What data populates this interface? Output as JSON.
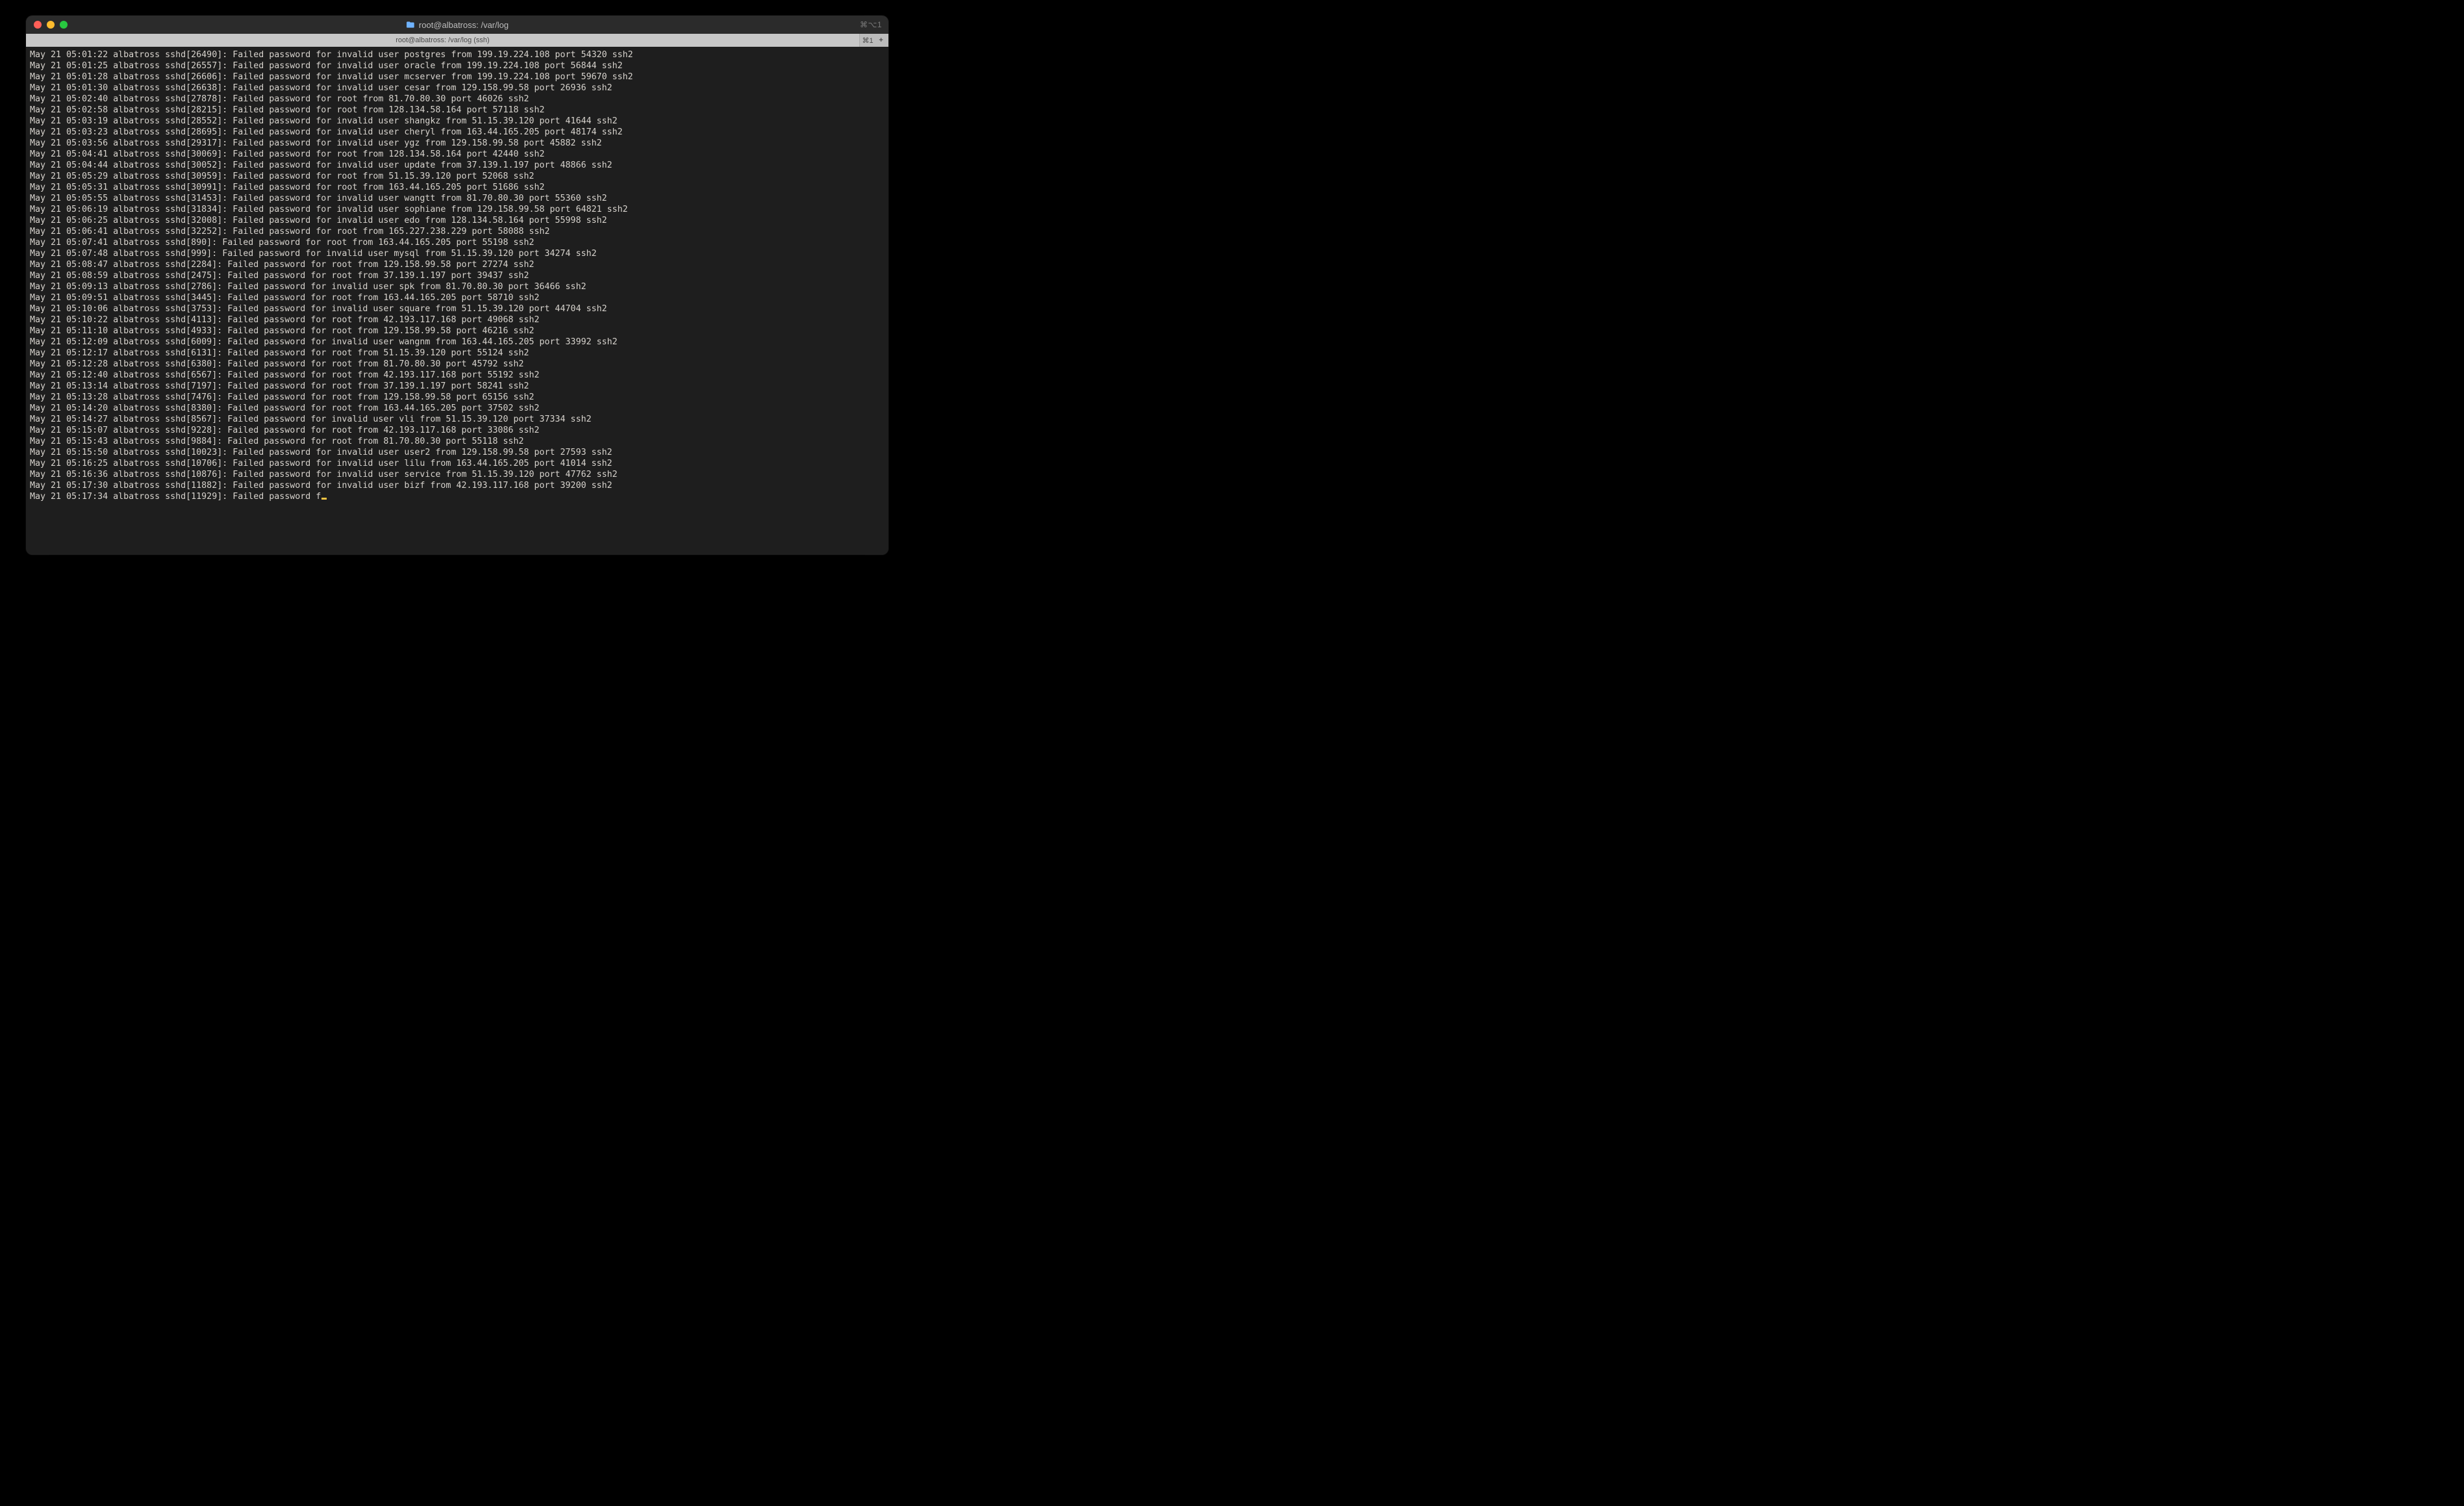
{
  "window": {
    "title": "root@albatross: /var/log",
    "shortcut_hint": "⌘⌥1"
  },
  "tab": {
    "label": "root@albatross: /var/log (ssh)",
    "pane_indicator": "⌘1"
  },
  "terminal": {
    "partial_line": "May 21 05:17:34 albatross sshd[11929]: Failed password f",
    "lines": [
      "May 21 05:01:22 albatross sshd[26490]: Failed password for invalid user postgres from 199.19.224.108 port 54320 ssh2",
      "May 21 05:01:25 albatross sshd[26557]: Failed password for invalid user oracle from 199.19.224.108 port 56844 ssh2",
      "May 21 05:01:28 albatross sshd[26606]: Failed password for invalid user mcserver from 199.19.224.108 port 59670 ssh2",
      "May 21 05:01:30 albatross sshd[26638]: Failed password for invalid user cesar from 129.158.99.58 port 26936 ssh2",
      "May 21 05:02:40 albatross sshd[27878]: Failed password for root from 81.70.80.30 port 46026 ssh2",
      "May 21 05:02:58 albatross sshd[28215]: Failed password for root from 128.134.58.164 port 57118 ssh2",
      "May 21 05:03:19 albatross sshd[28552]: Failed password for invalid user shangkz from 51.15.39.120 port 41644 ssh2",
      "May 21 05:03:23 albatross sshd[28695]: Failed password for invalid user cheryl from 163.44.165.205 port 48174 ssh2",
      "May 21 05:03:56 albatross sshd[29317]: Failed password for invalid user ygz from 129.158.99.58 port 45882 ssh2",
      "May 21 05:04:41 albatross sshd[30069]: Failed password for root from 128.134.58.164 port 42440 ssh2",
      "May 21 05:04:44 albatross sshd[30052]: Failed password for invalid user update from 37.139.1.197 port 48866 ssh2",
      "May 21 05:05:29 albatross sshd[30959]: Failed password for root from 51.15.39.120 port 52068 ssh2",
      "May 21 05:05:31 albatross sshd[30991]: Failed password for root from 163.44.165.205 port 51686 ssh2",
      "May 21 05:05:55 albatross sshd[31453]: Failed password for invalid user wangtt from 81.70.80.30 port 55360 ssh2",
      "May 21 05:06:19 albatross sshd[31834]: Failed password for invalid user sophiane from 129.158.99.58 port 64821 ssh2",
      "May 21 05:06:25 albatross sshd[32008]: Failed password for invalid user edo from 128.134.58.164 port 55998 ssh2",
      "May 21 05:06:41 albatross sshd[32252]: Failed password for root from 165.227.238.229 port 58088 ssh2",
      "May 21 05:07:41 albatross sshd[890]: Failed password for root from 163.44.165.205 port 55198 ssh2",
      "May 21 05:07:48 albatross sshd[999]: Failed password for invalid user mysql from 51.15.39.120 port 34274 ssh2",
      "May 21 05:08:47 albatross sshd[2284]: Failed password for root from 129.158.99.58 port 27274 ssh2",
      "May 21 05:08:59 albatross sshd[2475]: Failed password for root from 37.139.1.197 port 39437 ssh2",
      "May 21 05:09:13 albatross sshd[2786]: Failed password for invalid user spk from 81.70.80.30 port 36466 ssh2",
      "May 21 05:09:51 albatross sshd[3445]: Failed password for root from 163.44.165.205 port 58710 ssh2",
      "May 21 05:10:06 albatross sshd[3753]: Failed password for invalid user square from 51.15.39.120 port 44704 ssh2",
      "May 21 05:10:22 albatross sshd[4113]: Failed password for root from 42.193.117.168 port 49068 ssh2",
      "May 21 05:11:10 albatross sshd[4933]: Failed password for root from 129.158.99.58 port 46216 ssh2",
      "May 21 05:12:09 albatross sshd[6009]: Failed password for invalid user wangnm from 163.44.165.205 port 33992 ssh2",
      "May 21 05:12:17 albatross sshd[6131]: Failed password for root from 51.15.39.120 port 55124 ssh2",
      "May 21 05:12:28 albatross sshd[6380]: Failed password for root from 81.70.80.30 port 45792 ssh2",
      "May 21 05:12:40 albatross sshd[6567]: Failed password for root from 42.193.117.168 port 55192 ssh2",
      "May 21 05:13:14 albatross sshd[7197]: Failed password for root from 37.139.1.197 port 58241 ssh2",
      "May 21 05:13:28 albatross sshd[7476]: Failed password for root from 129.158.99.58 port 65156 ssh2",
      "May 21 05:14:20 albatross sshd[8380]: Failed password for root from 163.44.165.205 port 37502 ssh2",
      "May 21 05:14:27 albatross sshd[8567]: Failed password for invalid user vli from 51.15.39.120 port 37334 ssh2",
      "May 21 05:15:07 albatross sshd[9228]: Failed password for root from 42.193.117.168 port 33086 ssh2",
      "May 21 05:15:43 albatross sshd[9884]: Failed password for root from 81.70.80.30 port 55118 ssh2",
      "May 21 05:15:50 albatross sshd[10023]: Failed password for invalid user user2 from 129.158.99.58 port 27593 ssh2",
      "May 21 05:16:25 albatross sshd[10706]: Failed password for invalid user lilu from 163.44.165.205 port 41014 ssh2",
      "May 21 05:16:36 albatross sshd[10876]: Failed password for invalid user service from 51.15.39.120 port 47762 ssh2",
      "May 21 05:17:30 albatross sshd[11882]: Failed password for invalid user bizf from 42.193.117.168 port 39200 ssh2"
    ]
  }
}
